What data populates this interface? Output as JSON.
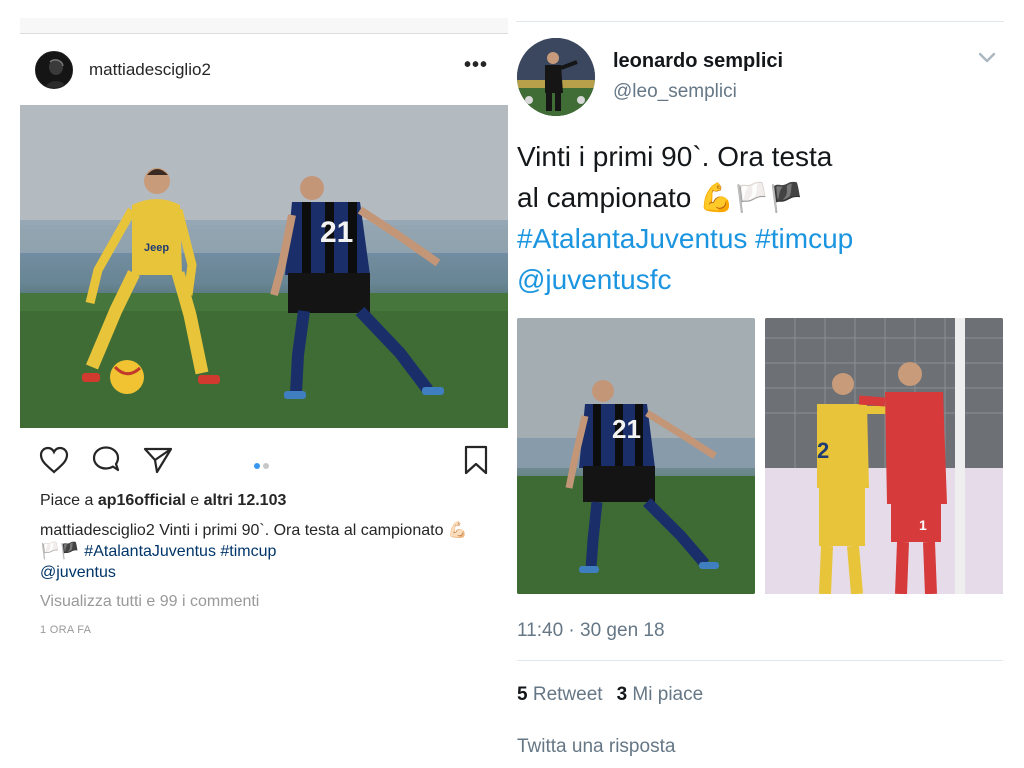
{
  "instagram": {
    "username": "mattiadesciglio2",
    "more_icon": "more-dots-icon",
    "likes": {
      "prefix": "Piace a ",
      "user": "ap16official",
      "middle": " e ",
      "count": "altri 12.103"
    },
    "caption": {
      "user": "mattiadesciglio2",
      "text": "Vinti i primi 90`. Ora testa al campionato 💪🏻🏳️🏴",
      "tag1": "#AtalantaJuventus",
      "tag2": "#timcup",
      "mention": "@juventus"
    },
    "view_comments": "Visualizza tutti e 99 i commenti",
    "time": "1 ORA FA",
    "carousel": {
      "total": 2,
      "active": 1
    },
    "player_number": "21",
    "sponsor": "Jeep"
  },
  "twitter": {
    "name": "leonardo semplici",
    "handle": "@leo_semplici",
    "text_line1": "Vinti i primi 90`. Ora testa",
    "text_line2": "al campionato 💪🏳️🏴",
    "hashtag1": "#AtalantaJuventus",
    "hashtag2": "#timcup",
    "mention": "@juventusfc",
    "photo1_number": "21",
    "photo2_number_left": "2",
    "photo2_number_right": "1",
    "timestamp": "11:40 · 30 gen 18",
    "retweets": {
      "count": "5",
      "label": "Retweet"
    },
    "likes": {
      "count": "3",
      "label": "Mi piace"
    },
    "reply_placeholder": "Twitta una risposta"
  },
  "colors": {
    "instagram_link": "#003569",
    "instagram_dot_active": "#3897f0",
    "twitter_link": "#1b95e0",
    "twitter_gray": "#657786"
  }
}
